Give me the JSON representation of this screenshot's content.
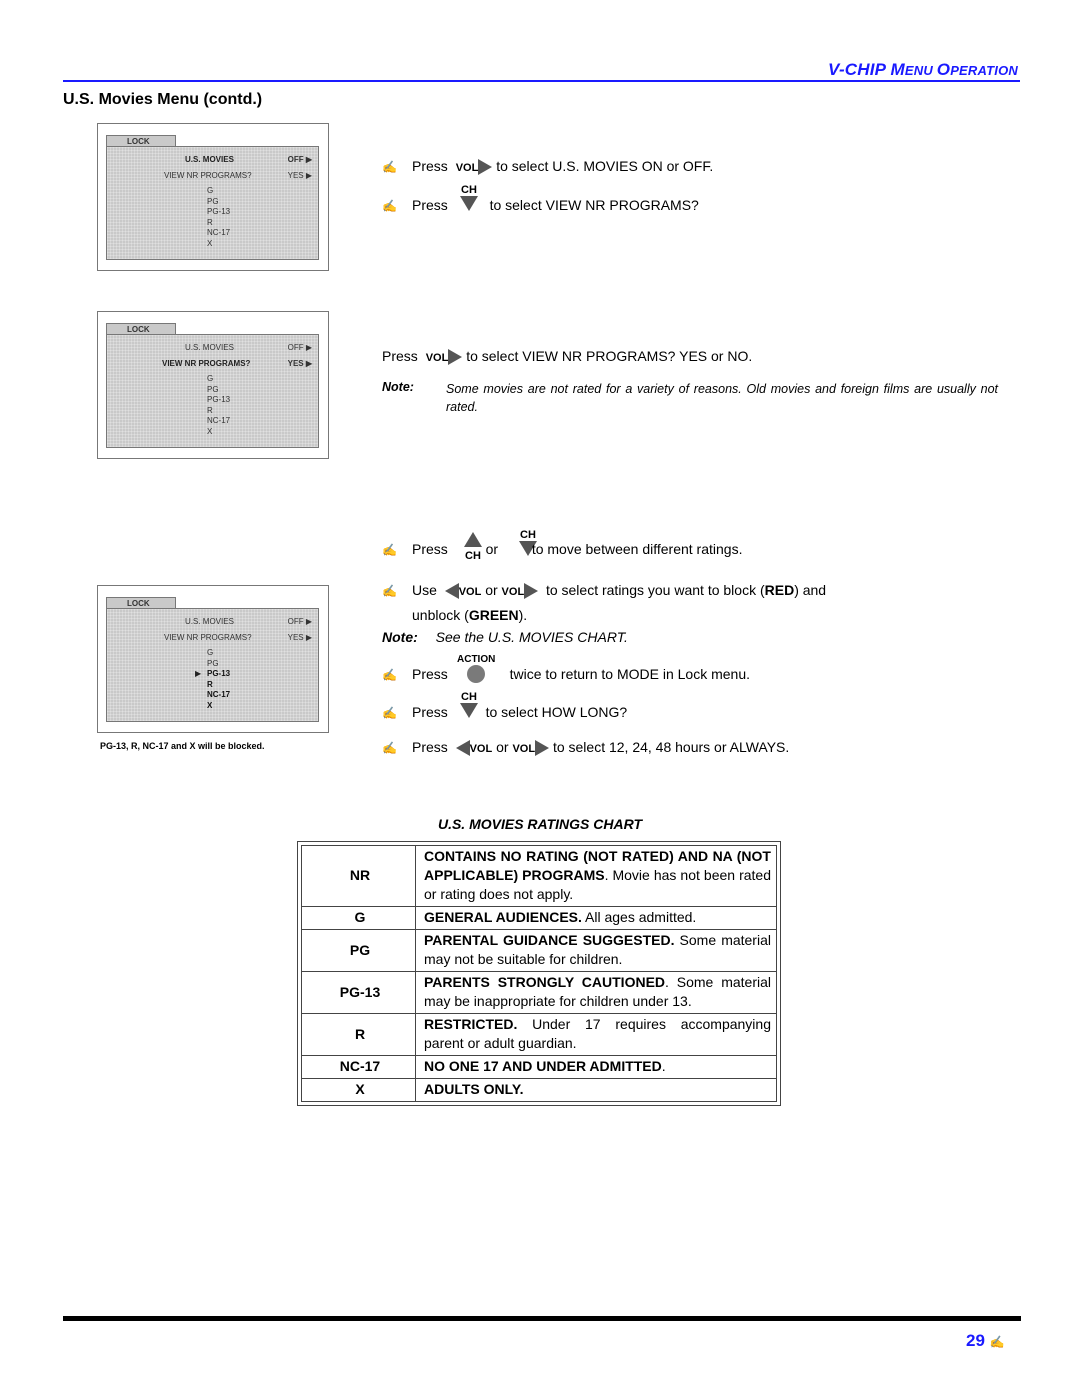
{
  "header": {
    "section_title_parts": [
      {
        "text": "V-C",
        "small": false
      },
      {
        "text": "HIP ",
        "small": false
      },
      {
        "text": "M",
        "small": false
      },
      {
        "text": "ENU ",
        "small": true
      },
      {
        "text": "O",
        "small": false
      },
      {
        "text": "PERATION",
        "small": true
      }
    ],
    "section_title": "V-CHIP MENU OPERATION",
    "page_heading": "U.S. Movies Menu (contd.)"
  },
  "screens": [
    {
      "tab": "LOCK",
      "rows": [
        {
          "label": "U.S. MOVIES",
          "value": "OFF ▶",
          "bold": true
        },
        {
          "label": "VIEW NR PROGRAMS?",
          "value": "YES ▶",
          "bold": false
        }
      ],
      "ratings": [
        "G",
        "PG",
        "PG-13",
        "R",
        "NC-17",
        "X"
      ],
      "blocked_from": null
    },
    {
      "tab": "LOCK",
      "rows": [
        {
          "label": "U.S. MOVIES",
          "value": "OFF ▶",
          "bold": false
        },
        {
          "label": "VIEW NR PROGRAMS?",
          "value": "YES ▶",
          "bold": true
        }
      ],
      "ratings": [
        "G",
        "PG",
        "PG-13",
        "R",
        "NC-17",
        "X"
      ],
      "blocked_from": null
    },
    {
      "tab": "LOCK",
      "rows": [
        {
          "label": "U.S. MOVIES",
          "value": "OFF ▶",
          "bold": false
        },
        {
          "label": "VIEW NR PROGRAMS?",
          "value": "YES ▶",
          "bold": false
        }
      ],
      "ratings": [
        "G",
        "PG",
        "PG-13",
        "R",
        "NC-17",
        "X"
      ],
      "blocked_from": 2,
      "caption": "PG-13, R, NC-17 and X will be blocked."
    }
  ],
  "instructions": {
    "bullet": "✍",
    "press": "Press",
    "use": "Use",
    "or": "or",
    "vol": "VOL",
    "ch": "CH",
    "action": "ACTION",
    "step1_text": "to select U.S. MOVIES ON or OFF.",
    "step2_text": "to select VIEW NR PROGRAMS?",
    "step3_text": "to select VIEW NR PROGRAMS? YES or NO.",
    "note_label": "Note:",
    "note1": "Some movies are not rated for a variety of reasons. Old movies and foreign films are usually not rated.",
    "step4_text": "to move between different ratings.",
    "step5_text_a": "to select ratings you want to block (",
    "step5_red": "RED",
    "step5_text_b": ") and",
    "step5_text_c": "unblock (",
    "step5_green": "GREEN",
    "step5_text_d": ").",
    "note2": "See the U.S. MOVIES CHART.",
    "step6_text": "twice to return to MODE in Lock menu.",
    "step7_text": "to select HOW LONG?",
    "step8_text": "to select 12, 24, 48 hours or ALWAYS."
  },
  "chart": {
    "title": "U.S. MOVIES RATINGS CHART",
    "rows": [
      {
        "code": "NR",
        "bold": "CONTAINS NO RATING (NOT RATED) AND NA (NOT APPLICABLE) PROGRAMS",
        "text": ". Movie has not been rated or rating does not apply."
      },
      {
        "code": "G",
        "bold": "GENERAL AUDIENCES.",
        "text": " All ages admitted."
      },
      {
        "code": "PG",
        "bold": "PARENTAL GUIDANCE SUGGESTED.",
        "text": " Some material may not be suitable for children."
      },
      {
        "code": "PG-13",
        "bold": "PARENTS STRONGLY CAUTIONED",
        "text": ". Some material may be inappropriate for children under 13."
      },
      {
        "code": "R",
        "bold": "RESTRICTED.",
        "text": " Under 17 requires accompanying parent or adult guardian."
      },
      {
        "code": "NC-17",
        "bold": "NO ONE 17 AND UNDER ADMITTED",
        "text": "."
      },
      {
        "code": "X",
        "bold": "ADULTS ONLY.",
        "text": ""
      }
    ]
  },
  "footer": {
    "page_number": "29",
    "pen_icon": "✍"
  },
  "colors": {
    "accent_blue": "#1a1aff",
    "screen_gray": "#c9c9c9",
    "key_gray": "#555555"
  }
}
